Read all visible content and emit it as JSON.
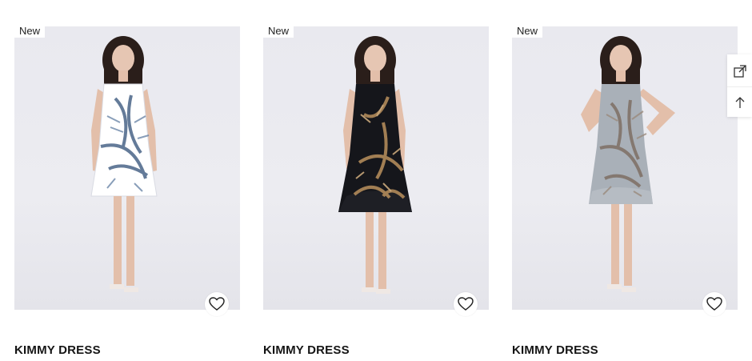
{
  "products": [
    {
      "badge": "New",
      "name": "KIMMY DRESS",
      "dress_color": "#ffffff",
      "print_color": "#3d5a80"
    },
    {
      "badge": "New",
      "name": "KIMMY DRESS",
      "dress_color": "#15161b",
      "print_color": "#b08a5a"
    },
    {
      "badge": "New",
      "name": "KIMMY DRESS",
      "dress_color": "#a9b0b8",
      "print_color": "#7a6a5e"
    }
  ],
  "side_tools": {
    "expand_icon": "expand-arrow-icon",
    "top_icon": "arrow-up-icon"
  }
}
